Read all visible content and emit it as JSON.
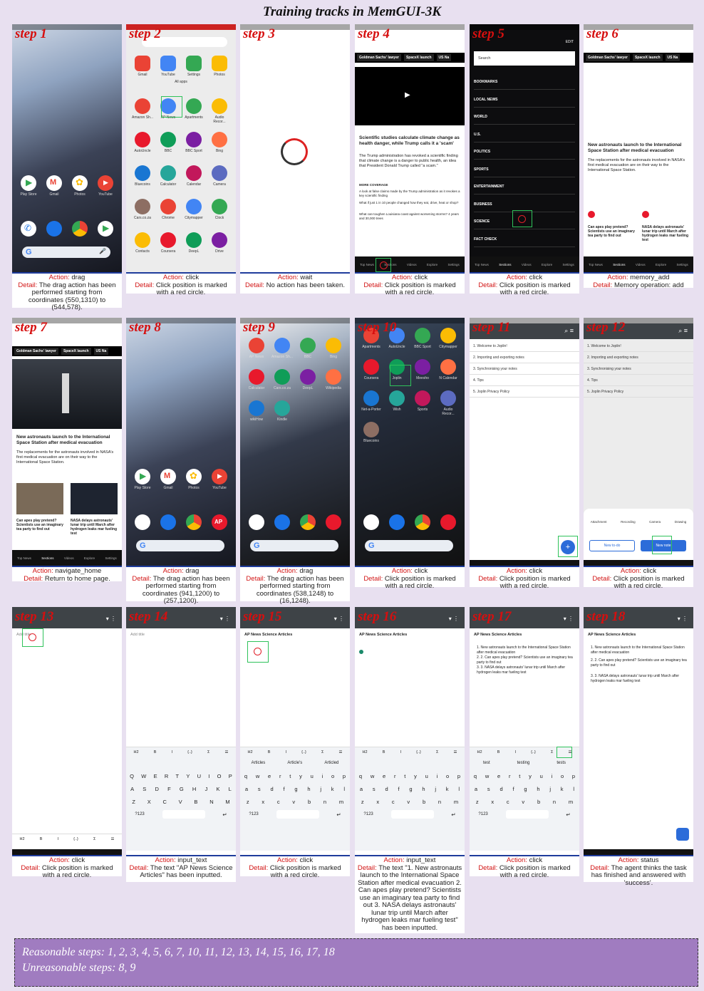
{
  "title": "Training tracks in MemGUI-3K",
  "steps": [
    {
      "label": "step 1",
      "action": "drag",
      "detail": "The drag action has been performed starting from coordinates (550,1310) to (544,578)."
    },
    {
      "label": "step 2",
      "action": "click",
      "detail": "Click position is marked with a red circle."
    },
    {
      "label": "step 3",
      "action": "wait",
      "detail": "No action has been taken."
    },
    {
      "label": "step 4",
      "action": "click",
      "detail": "Click position is marked with a red circle."
    },
    {
      "label": "step 5",
      "action": "click",
      "detail": "Click position is marked with a red circle."
    },
    {
      "label": "step 6",
      "action": "memory_add",
      "detail": "Memory operation: add"
    },
    {
      "label": "step 7",
      "action": "navigate_home",
      "detail": "Return to home page."
    },
    {
      "label": "step 8",
      "action": "drag",
      "detail": "The drag action has been performed starting from coordinates (941,1200) to (257,1200)."
    },
    {
      "label": "step 9",
      "action": "drag",
      "detail": "The drag action has been performed starting from coordinates (538,1248) to (16,1248)."
    },
    {
      "label": "step 10",
      "action": "click",
      "detail": "Click position is marked with a red circle."
    },
    {
      "label": "step 11",
      "action": "click",
      "detail": "Click position is marked with a red circle."
    },
    {
      "label": "step 12",
      "action": "click",
      "detail": "Click position is marked with a red circle."
    },
    {
      "label": "step 13",
      "action": "click",
      "detail": "Click position is marked with a red circle."
    },
    {
      "label": "step 14",
      "action": "input_text",
      "detail": "The text \"AP News Science Articles\" has been inputted."
    },
    {
      "label": "step 15",
      "action": "click",
      "detail": "Click position is marked with a red circle."
    },
    {
      "label": "step 16",
      "action": "input_text",
      "detail": "The text \"1. New astronauts launch to the International Space Station after medical evacuation 2. Can apes play pretend? Scientists use an imaginary tea party to find out 3. NASA delays astronauts' lunar trip until March after hydrogen leaks mar fueling test\" has been inputted."
    },
    {
      "label": "step 17",
      "action": "click",
      "detail": "Click position is marked with a red circle."
    },
    {
      "label": "step 18",
      "action": "status",
      "detail": "The agent thinks the task has finished and answered with 'success'."
    }
  ],
  "labels": {
    "action": "Action:",
    "detail": "Detail:"
  },
  "home": {
    "apps": [
      "Play Store",
      "Gmail",
      "Photos",
      "YouTube"
    ]
  },
  "drawer": {
    "top": [
      "Gmail",
      "YouTube",
      "Settings",
      "Photos"
    ],
    "all_apps": "All apps",
    "rows": [
      [
        "Amazon Sh...",
        "AP News",
        "Apartments",
        "Audio Recor..."
      ],
      [
        "AutoUncle",
        "BBC",
        "BBC Sport",
        "Bing"
      ],
      [
        "Bluecoins",
        "Calculator",
        "Calendar",
        "Camera"
      ],
      [
        "Cars.co.za",
        "Chrome",
        "Citymapper",
        "Clock"
      ],
      [
        "Contacts",
        "Coursera",
        "DeepL",
        "Drive"
      ]
    ]
  },
  "news": {
    "chips": [
      "Goldman Sachs' lawyer",
      "SpaceX launch",
      "US Na"
    ],
    "headline4": "Scientific studies calculate climate change as health danger, while Trump calls it a 'scam'",
    "body4": "The Trump administration has revoked a scientific finding that climate change is a danger to public health, an idea that President Donald Trump called \"a scam.\"",
    "more": "MORE COVERAGE",
    "bullets": [
      "A look at false claims made by the Trump administration as it revokes a key scientific finding",
      "What if just 1 in 10 people changed how they eat, drive, heat or shop?",
      "What can toughen Louisiana coast against worsening storms? 4 years and 30,000 trees"
    ],
    "tabs": [
      "Top News",
      "Sections",
      "Videos",
      "Explore",
      "Settings"
    ],
    "sections_title": "SECTIONS",
    "edit": "EDIT",
    "search": "Search",
    "sections": [
      "BOOKMARKS",
      "LOCAL NEWS",
      "WORLD",
      "U.S.",
      "POLITICS",
      "SPORTS",
      "ENTERTAINMENT",
      "BUSINESS",
      "SCIENCE",
      "FACT CHECK"
    ],
    "science": "SCIENCE",
    "headline6": "New astronauts launch to the International Space Station after medical evacuation",
    "body6": "The replacements for the astronauts involved in NASA's first medical evacuation are on their way to the International Space Station.",
    "card1": "Can apes play pretend? Scientists use an imaginary tea party to find out",
    "card2": "NASA delays astronauts' lunar trip until March after hydrogen leaks mar fueling test"
  },
  "drawer2": {
    "apps9": [
      "AP News",
      "Amazon Sh...",
      "BBC",
      "Bing",
      "Calculator",
      "Cars.co.za",
      "DeepL",
      "Wikipedia",
      "wikiHow",
      "Kindle"
    ],
    "apps10": [
      "Apartments",
      "AutoUncle",
      "BBC Sport",
      "Citymapper",
      "Coursera",
      "Joplin",
      "Meesho",
      "N Calendar",
      "Net-a-Porter",
      "Wish",
      "Sports",
      "Audio Recor...",
      "Bluecoins"
    ]
  },
  "joplin": {
    "notes": [
      "1. Welcome to Joplin!",
      "2. Importing and exporting notes",
      "3. Synchronising your notes",
      "4. Tips",
      "5. Joplin Privacy Policy"
    ],
    "sheet": [
      "Attachment",
      "Recording",
      "Camera",
      "Drawing"
    ],
    "new_todo": "New to-do",
    "new_note": "New note",
    "add_title": "Add title",
    "note_title": "AP News Science Articles",
    "list1": "1. New astronauts launch to the International Space Station after medical evacuation",
    "list2": "2. 2. Can apes play pretend? Scientists use an imaginary tea party to find out",
    "list3": "3. 3. NASA delays astronauts' lunar trip until March after hydrogen leaks mar fueling test",
    "toolbar": [
      "H2",
      "B",
      "I",
      "{..}",
      "Σ",
      "☰"
    ],
    "kb_rows": [
      "QWERTYUIOP",
      "ASDFGHJKL",
      "ZXCVBNM"
    ],
    "sug15": [
      "Articles",
      "Article's",
      "Articled"
    ],
    "sug17": [
      "test",
      "testing",
      "tests"
    ],
    "num": "?123"
  },
  "summary": {
    "reasonable": "Reasonable steps: 1, 2, 3, 4, 5, 6, 7, 10, 11, 12, 13, 14, 15, 16, 17, 18",
    "unreasonable": "Unreasonable steps: 8, 9"
  }
}
